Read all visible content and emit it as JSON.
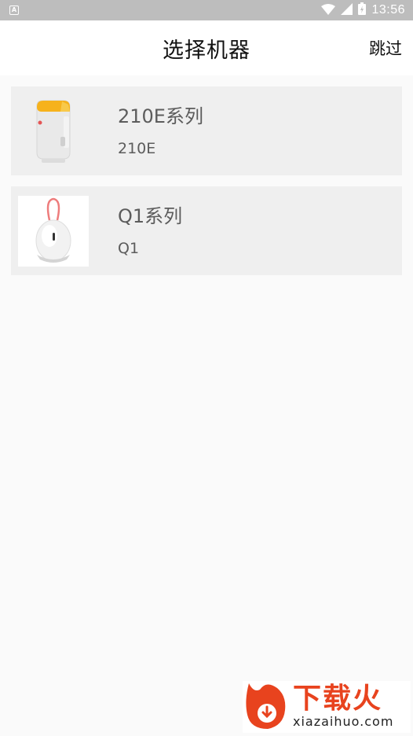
{
  "status_bar": {
    "notification_icon_letter": "A",
    "time": "13:56",
    "icons": [
      "wifi-icon",
      "signal-icon",
      "battery-charging-icon"
    ]
  },
  "header": {
    "title": "选择机器",
    "skip_label": "跳过"
  },
  "devices": [
    {
      "series": "210E系列",
      "model": "210E",
      "icon": "label-printer-210e-image"
    },
    {
      "series": "Q1系列",
      "model": "Q1",
      "icon": "egg-printer-q1-image"
    }
  ],
  "watermark": {
    "brand": "下载火",
    "domain": "xiazaihuo.com"
  },
  "colors": {
    "status_bar": "#bdbdbd",
    "card_background": "#efefef",
    "text_gray": "#5c5c5c",
    "accent_yellow": "#f6b21c",
    "watermark_red": "#e8431e"
  }
}
